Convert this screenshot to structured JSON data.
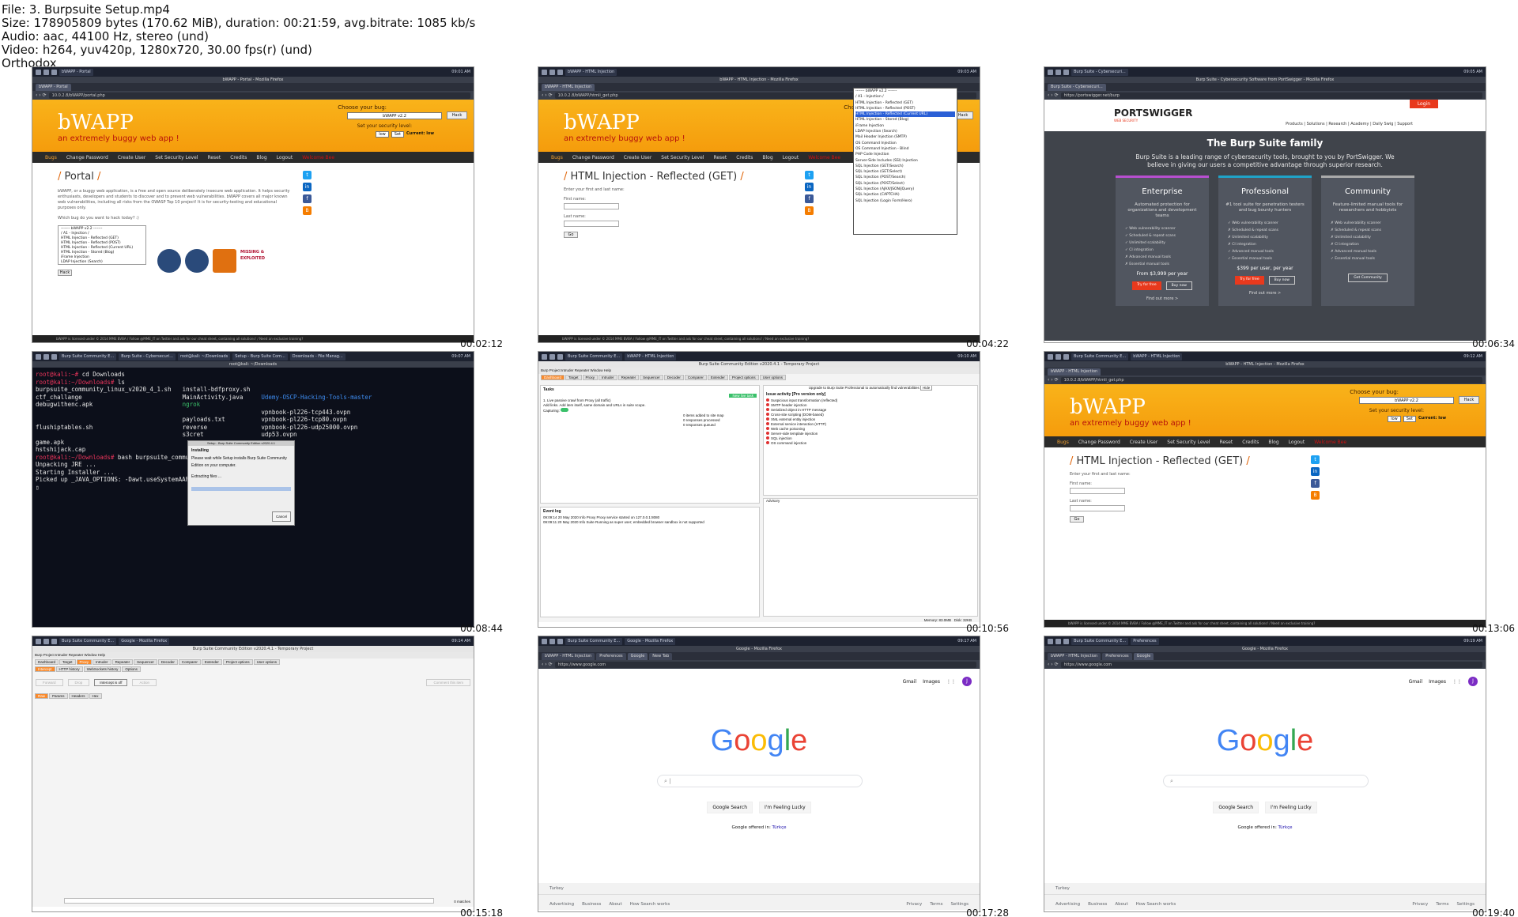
{
  "meta": {
    "file": "File: 3. Burpsuite Setup.mp4",
    "size": "Size: 178905809 bytes (170.62 MiB), duration: 00:21:59, avg.bitrate: 1085 kb/s",
    "audio": "Audio: aac, 44100 Hz, stereo (und)",
    "video": "Video: h264, yuv420p, 1280x720, 30.00 fps(r) (und)",
    "brand": "Orthodox"
  },
  "timestamps": [
    "00:02:12",
    "00:04:22",
    "00:06:34",
    "00:08:44",
    "00:10:56",
    "00:13:06",
    "00:15:18",
    "00:17:28",
    "00:19:40"
  ],
  "bwapp": {
    "logo": "bWAPP",
    "tagline": "an extremely buggy web app !",
    "choose": "Choose your bug:",
    "selected": "bWAPP v2.2",
    "hack": "Hack",
    "security": "Set your security level:",
    "level": "low",
    "set": "Set",
    "current": "Current: low",
    "nav": [
      "Bugs",
      "Change Password",
      "Create User",
      "Set Security Level",
      "Reset",
      "Credits",
      "Blog",
      "Logout",
      "Welcome Bee"
    ],
    "portal_title": "Portal",
    "portal_text": "bWAPP, or a buggy web application, is a free and open source deliberately insecure web application. It helps security enthusiasts, developers and students to discover and to prevent web vulnerabilities. bWAPP covers all major known web vulnerabilities, including all risks from the OWASP Top 10 project! It is for security-testing and educational purposes only.",
    "which_bug": "Which bug do you want to hack today? :)",
    "buglist": [
      "------- bWAPP v2.2 -------",
      "/ A1 - Injection /",
      "HTML Injection - Reflected (GET)",
      "HTML Injection - Reflected (POST)",
      "HTML Injection - Reflected (Current URL)",
      "HTML Injection - Stored (Blog)",
      "iFrame Injection",
      "LDAP Injection (Search)",
      "Mail Header Injection (SMTP)"
    ],
    "html_title": "HTML Injection - Reflected (GET)",
    "enter_name": "Enter your first and last name:",
    "first": "First name:",
    "last": "Last name:",
    "go": "Go",
    "footer": "bWAPP is licensed under  © 2014 MME BVBA / Follow @MME_IT on Twitter and ask for our cheat sheet, containing all solutions! / Need an exclusive training?",
    "dropdown": [
      "------- bWAPP v2.2 -------",
      "/ A1 - Injection /",
      "HTML Injection - Reflected (GET)",
      "HTML Injection - Reflected (POST)",
      "HTML Injection - Reflected (Current URL)",
      "HTML Injection - Stored (Blog)",
      "iFrame Injection",
      "LDAP Injection (Search)",
      "Mail Header Injection (SMTP)",
      "OS Command Injection",
      "OS Command Injection - Blind",
      "PHP Code Injection",
      "Server-Side Includes (SSI) Injection",
      "SQL Injection (GET/Search)",
      "SQL Injection (GET/Select)",
      "SQL Injection (POST/Search)",
      "SQL Injection (POST/Select)",
      "SQL Injection (AJAX/JSON/jQuery)",
      "SQL Injection (CAPTCHA)",
      "SQL Injection (Login Form/Hero)"
    ]
  },
  "tabs": {
    "t1": [
      "bWAPP - Portal"
    ],
    "t2": [
      "bWAPP - HTML Injection"
    ],
    "t3": [
      "Burp Suite - Cybersecuri..."
    ],
    "t8": [
      "bWAPP - HTML Injection",
      "Preferences",
      "Google",
      "New Tab"
    ],
    "t9": [
      "bWAPP - HTML Injection",
      "Preferences",
      "Google"
    ]
  },
  "urls": {
    "portal": "10.0.2.8/bWAPP/portal.php",
    "html": "10.0.2.8/bWAPP/htmli_get.php",
    "ps": "https://portswigger.net/burp",
    "google": "https://www.google.com"
  },
  "titles": {
    "t1": "bWAPP - Portal - Mozilla Firefox",
    "t2": "bWAPP - HTML Injection - Mozilla Firefox",
    "t3": "Burp Suite - Cybersecurity Software from PortSwigger - Mozilla Firefox",
    "t5": "Burp Suite Community Edition v2020.4.1 - Temporary Project",
    "t7": "Burp Suite Community Edition v2020.4.1 - Temporary Project",
    "t8": "Google - Mozilla Firefox",
    "t9": "Google - Mozilla Firefox"
  },
  "portswigger": {
    "login": "Login",
    "logo": "PORTSWIGGER",
    "logo_sub": "WEB SECURITY",
    "nav": "Products  |  Solutions  |  Research  |  Academy  |  Daily Swig  |  Support",
    "heading": "The Burp Suite family",
    "intro": "Burp Suite is a leading range of cybersecurity tools, brought to you by PortSwigger. We believe in giving our users a competitive advantage through superior research.",
    "cards": [
      {
        "name": "Enterprise",
        "desc": "Automated protection for organizations and development teams",
        "features": [
          "Web vulnerability scanner",
          "Scheduled & repeat scans",
          "Unlimited scalability",
          "CI integration",
          "Advanced manual tools",
          "Essential manual tools"
        ],
        "price": "From $3,999 per year",
        "b1": "Try for free",
        "b2": "Buy now",
        "more": "Find out more >"
      },
      {
        "name": "Professional",
        "desc": "#1 tool suite for penetration testers and bug bounty hunters",
        "features": [
          "Web vulnerability scanner",
          "Scheduled & repeat scans",
          "Unlimited scalability",
          "CI integration",
          "Advanced manual tools",
          "Essential manual tools"
        ],
        "price": "$399 per user, per year",
        "b1": "Try for free",
        "b2": "Buy now",
        "more": "Find out more >"
      },
      {
        "name": "Community",
        "desc": "Feature-limited manual tools for researchers and hobbyists",
        "features": [
          "Web vulnerability scanner",
          "Scheduled & repeat scans",
          "Unlimited scalability",
          "CI integration",
          "Advanced manual tools",
          "Essential manual tools"
        ],
        "price": "",
        "b1": "Get Community",
        "b2": "",
        "more": ""
      }
    ]
  },
  "terminal": {
    "taskbar": [
      "Burp Suite Community E...",
      "Burp Suite - Cybersecuri...",
      "root@kali: ~/Downloads",
      "Setup - Burp Suite Com...",
      "Downloads - File Manag..."
    ],
    "title": "root@kali: ~/Downloads",
    "lines": [
      {
        "p": "root@kali:~#",
        "t": " cd Downloads"
      },
      {
        "p": "root@kali:~/Downloads#",
        "t": " ls"
      }
    ],
    "ls_col1": [
      "burpsuite_community_linux_v2020_4_1.sh",
      "",
      "ctf_challange",
      "debugwithenc.apk",
      "",
      "",
      "flushiptables.sh",
      "",
      "game.apk",
      "hstshijack.cap"
    ],
    "ls_col2": [
      "install-bdfproxy.sh",
      "MainActivity.java",
      "ngrok",
      "",
      "payloads.txt",
      "reverse",
      "s3cret",
      "",
      "",
      ""
    ],
    "ls_col3": [
      "",
      "Udemy-OSCP-Hacking-Tools-master",
      "",
      "vpnbook-pl226-tcp443.ovpn",
      "vpnbook-pl226-tcp80.ovpn",
      "vpnbook-pl226-udp25000.ovpn",
      "udp53.ovpn",
      "",
      "",
      ""
    ],
    "cmd": {
      "p": "root@kali:~/Downloads#",
      "t": " bash burpsuite_community"
    },
    "out": [
      "Unpacking JRE ...",
      "Starting Installer ...",
      "Picked up _JAVA_OPTIONS: -Dawt.useSystemAAFontSe"
    ],
    "installer_title": "Setup - Burp Suite Community Edition v2020.4.1",
    "installer_head": "Installing",
    "installer_msg": "Please wait while Setup installs Burp Suite Community Edition on your computer.",
    "installer_step": "Extracting files ...",
    "cancel": "Cancel"
  },
  "burp": {
    "menu": "Burp  Project  Intruder  Repeater  Window  Help",
    "tabs": [
      "Dashboard",
      "Target",
      "Proxy",
      "Intruder",
      "Repeater",
      "Sequencer",
      "Decoder",
      "Comparer",
      "Extender",
      "Project options",
      "User options"
    ],
    "tasks": "Tasks",
    "new_live": "New live task",
    "task1": "1. Live passive crawl from Proxy (all traffic)",
    "task_desc": "Add links. Add item itself, same domain and URLs in suite scope.",
    "capturing": "Capturing:",
    "stats": [
      "0 items added to site map",
      "0 responses processed",
      "0 responses queued"
    ],
    "issue_title": "Issue activity [Pro version only]",
    "upgrade": "Upgrade to Burp Suite Professional to automatically find vulnerabilities",
    "hide": "Hide",
    "issues": [
      "Suspicious input transformation (reflected)",
      "SMTP header injection",
      "Serialized object in HTTP message",
      "Cross-site scripting (DOM-based)",
      "XML external entity injection",
      "External service interaction (HTTP)",
      "Web cache poisoning",
      "Server-side template injection",
      "SQL injection",
      "OS command injection"
    ],
    "event_log": "Event log",
    "events": [
      "09:09:14 20 May 2020   Info   Proxy   Proxy service started on 127.0.0.1:8080",
      "09:09:11 20 May 2020   Info   Suite   Running as super user; embedded browser sandbox is not supported"
    ],
    "memory": "Memory: 83.0MB",
    "disk": "Disk: 32KB",
    "advisory": "Advisory",
    "proxy_tabs": [
      "Intercept",
      "HTTP history",
      "WebSockets history",
      "Options"
    ],
    "forward": "Forward",
    "drop": "Drop",
    "intercept": "Intercept is off",
    "action": "Action",
    "comment": "Comment this item",
    "raw_tabs": [
      "Raw",
      "Params",
      "Headers",
      "Hex"
    ],
    "matches": "0 matches"
  },
  "google": {
    "gmail": "Gmail",
    "images": "Images",
    "avatar": "J",
    "logo": "Google",
    "search_btn": "Google Search",
    "lucky": "I'm Feeling Lucky",
    "offered": "Google offered in:",
    "lang": "Türkçe",
    "country": "Turkey",
    "foot_left": [
      "Advertising",
      "Business",
      "About",
      "How Search works"
    ],
    "foot_right": [
      "Privacy",
      "Terms",
      "Settings"
    ]
  },
  "colors": {
    "accent": "#f59c0c",
    "burp_orange": "#f98a2c",
    "ps_red": "#e8391d"
  }
}
